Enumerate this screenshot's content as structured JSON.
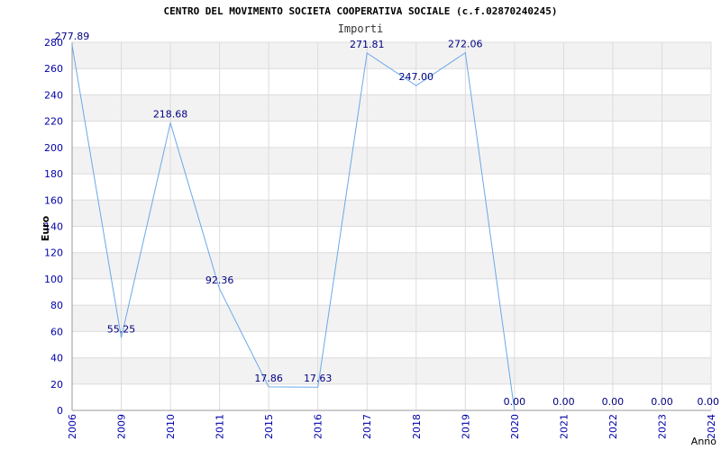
{
  "chart_data": {
    "type": "line",
    "title": "CENTRO DEL MOVIMENTO SOCIETA COOPERATIVA SOCIALE (c.f.02870240245)",
    "subtitle": "Importi",
    "xlabel": "Anno",
    "ylabel": "Euro",
    "ylim": [
      0,
      280
    ],
    "ytick_step": 20,
    "grid": true,
    "categories": [
      "2006",
      "2009",
      "2010",
      "2011",
      "2015",
      "2016",
      "2017",
      "2018",
      "2019",
      "2020",
      "2021",
      "2022",
      "2023",
      "2024"
    ],
    "series": [
      {
        "values": [
          277.89,
          55.25,
          218.68,
          92.36,
          17.86,
          17.63,
          271.81,
          247.0,
          272.06,
          0.0,
          0.0,
          0.0,
          0.0,
          0.0
        ],
        "labels": [
          "277.89",
          "55.25",
          "218.68",
          "92.36",
          "17.86",
          "17.63",
          "271.81",
          "247.00",
          "272.06",
          "0.00",
          "0.00",
          "0.00",
          "0.00",
          "0.00"
        ],
        "color": "#6aa8e8",
        "line_end_index": 9
      }
    ],
    "colors": {
      "tick_text": "#0000aa",
      "value_label": "#000080",
      "band": "#f2f2f2",
      "gridline": "#dcdcdc"
    }
  }
}
